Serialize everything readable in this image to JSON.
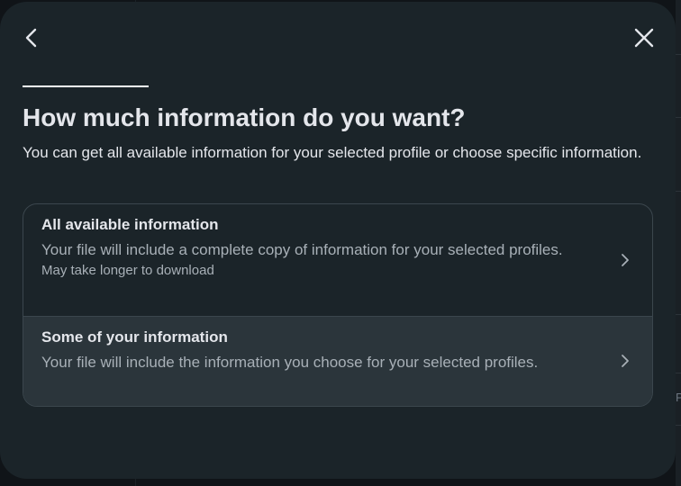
{
  "dialog": {
    "back_icon": "chevron-left-icon",
    "close_icon": "close-icon",
    "title": "How much information do you want?",
    "subtitle": "You can get all available information for your selected profile or choose specific information."
  },
  "options": [
    {
      "title": "All available information",
      "description": "Your file will include a complete copy of information for your selected profiles.",
      "note": "May take longer to download",
      "icon": "chevron-right-icon"
    },
    {
      "title": "Some of your information",
      "description": "Your file will include the information you choose for your selected profiles.",
      "icon": "chevron-right-icon",
      "highlighted": true
    }
  ],
  "colors": {
    "modal_background": "#1b2429",
    "text_primary": "#e4e6eb",
    "text_secondary": "#a8b0b7",
    "border": "#3b464d",
    "highlight": "#2b353b"
  },
  "background": {
    "edge_glyph": "P"
  }
}
